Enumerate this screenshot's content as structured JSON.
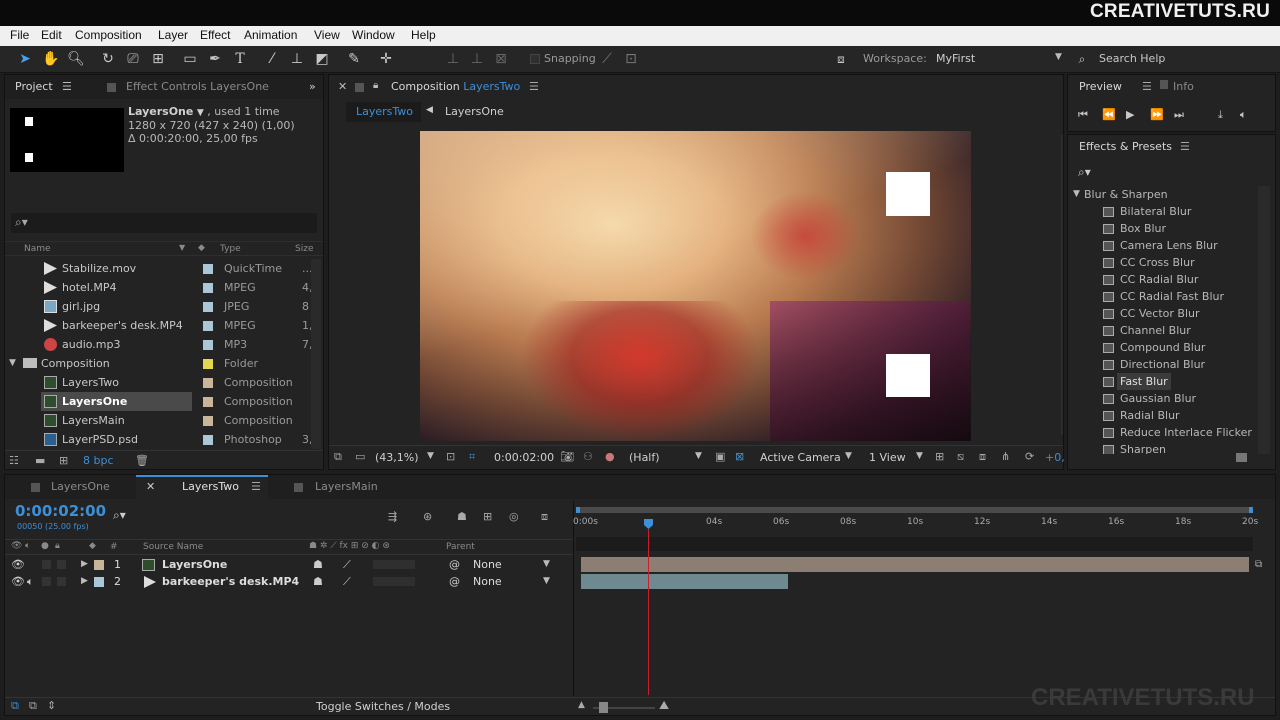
{
  "watermark": {
    "brand": "CREATIVETUTS.RU",
    "bottom": "CREATIVETUTS.RU"
  },
  "menu": [
    "File",
    "Edit",
    "Composition",
    "Layer",
    "Effect",
    "Animation",
    "View",
    "Window",
    "Help"
  ],
  "toolbar": {
    "snapping_label": "Snapping",
    "workspace_label": "Workspace:",
    "workspace_value": "MyFirst",
    "search_help": "Search Help"
  },
  "project": {
    "tab_project": "Project",
    "tab_effect_controls": "Effect Controls LayersOne",
    "item_name": "LayersOne",
    "item_used": ", used 1 time",
    "item_dims": "1280 x 720  (427 x 240) (1,00)",
    "item_duration": "Δ 0:00:20:00, 25,00 fps",
    "columns": {
      "name": "Name",
      "type": "Type",
      "size": "Size"
    },
    "files": [
      {
        "name": "Stabilize.mov",
        "type": "QuickTime",
        "size": "...",
        "tag": "#a9c7d6",
        "icon": "video-icon"
      },
      {
        "name": "hotel.MP4",
        "type": "MPEG",
        "size": "4,",
        "tag": "#a9c7d6",
        "icon": "video-icon"
      },
      {
        "name": "girl.jpg",
        "type": "JPEG",
        "size": "8",
        "tag": "#a9c7d6",
        "icon": "image-icon"
      },
      {
        "name": "barkeeper's desk.MP4",
        "type": "MPEG",
        "size": "1,",
        "tag": "#a9c7d6",
        "icon": "video-icon"
      },
      {
        "name": "audio.mp3",
        "type": "MP3",
        "size": "7,",
        "tag": "#a9c7d6",
        "icon": "audio-icon"
      }
    ],
    "folder": {
      "name": "Composition",
      "type": "Folder",
      "tag": "#e4d84c"
    },
    "comps": [
      {
        "name": "LayersTwo",
        "type": "Composition",
        "size": "",
        "tag": "#c9b59a",
        "selected": false
      },
      {
        "name": "LayersOne",
        "type": "Composition",
        "size": "",
        "tag": "#c9b59a",
        "selected": true
      },
      {
        "name": "LayersMain",
        "type": "Composition",
        "size": "",
        "tag": "#c9b59a",
        "selected": false
      },
      {
        "name": "LayerPSD.psd",
        "type": "Photoshop",
        "size": "3,",
        "tag": "#a9c7d6",
        "selected": false
      }
    ],
    "bpc": "8 bpc"
  },
  "composition": {
    "tab_prefix": "Composition",
    "tab_name": "LayersTwo",
    "breadcrumb_active": "LayersTwo",
    "breadcrumb_parent": "LayersOne",
    "zoom": "(43,1%)",
    "timecode": "0:00:02:00",
    "resolution": "(Half)",
    "camera": "Active Camera",
    "views": "1 View",
    "exposure": "+0,"
  },
  "preview": {
    "tab_preview": "Preview",
    "tab_info": "Info"
  },
  "effects": {
    "title": "Effects & Presets",
    "category": "Blur & Sharpen",
    "items": [
      {
        "label": "Bilateral Blur",
        "selected": false
      },
      {
        "label": "Box Blur",
        "selected": false
      },
      {
        "label": "Camera Lens Blur",
        "selected": false
      },
      {
        "label": "CC Cross Blur",
        "selected": false
      },
      {
        "label": "CC Radial Blur",
        "selected": false
      },
      {
        "label": "CC Radial Fast Blur",
        "selected": false
      },
      {
        "label": "CC Vector Blur",
        "selected": false
      },
      {
        "label": "Channel Blur",
        "selected": false
      },
      {
        "label": "Compound Blur",
        "selected": false
      },
      {
        "label": "Directional Blur",
        "selected": false
      },
      {
        "label": "Fast Blur",
        "selected": true
      },
      {
        "label": "Gaussian Blur",
        "selected": false
      },
      {
        "label": "Radial Blur",
        "selected": false
      },
      {
        "label": "Reduce Interlace Flicker",
        "selected": false
      },
      {
        "label": "Sharpen",
        "selected": false
      }
    ]
  },
  "timeline": {
    "tabs": [
      {
        "label": "LayersOne",
        "active": false
      },
      {
        "label": "LayersTwo",
        "active": true
      },
      {
        "label": "LayersMain",
        "active": false
      }
    ],
    "timecode": "0:00:02:00",
    "frames": "00050 (25.00 fps)",
    "col_num": "#",
    "col_source": "Source Name",
    "col_parent": "Parent",
    "layers": [
      {
        "num": "1",
        "name": "LayersOne",
        "parent": "None",
        "tag": "#c9b59a"
      },
      {
        "num": "2",
        "name": "barkeeper's desk.MP4",
        "parent": "None",
        "tag": "#a9c7d6"
      }
    ],
    "ruler": [
      "0:00s",
      "04s",
      "06s",
      "08s",
      "10s",
      "12s",
      "14s",
      "16s",
      "18s",
      "20s"
    ],
    "toggle_label": "Toggle Switches / Modes",
    "accent": "#3d8fd6",
    "playhead_color": "#c8202a"
  }
}
